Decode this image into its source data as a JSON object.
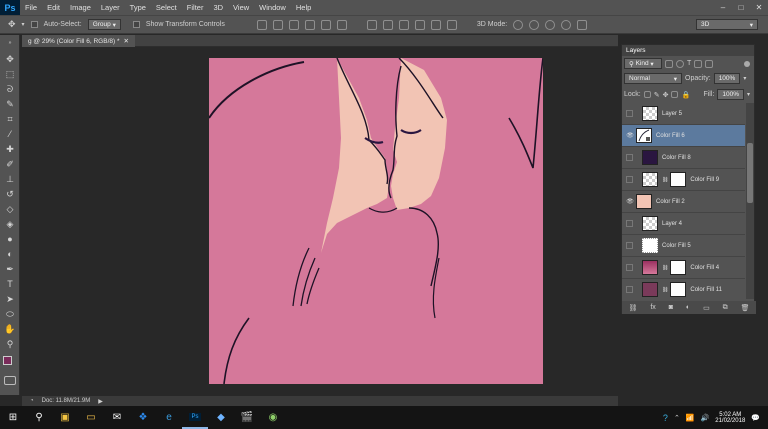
{
  "menubar": {
    "logo": "Ps",
    "items": [
      "File",
      "Edit",
      "Image",
      "Layer",
      "Type",
      "Select",
      "Filter",
      "3D",
      "View",
      "Window",
      "Help"
    ]
  },
  "options": {
    "auto_select_label": "Auto-Select:",
    "auto_select_value": "Group",
    "show_transform_label": "Show Transform Controls",
    "mode_3d_label": "3D Mode:",
    "workspace_value": "3D"
  },
  "document": {
    "tab_title": "g @ 29% (Color Fill 6, RGB/8) *",
    "doc_size": "Doc: 11.8M/21.9M"
  },
  "layers_panel": {
    "title": "Layers",
    "filter_label": "Kind",
    "blend_mode": "Normal",
    "opacity_label": "Opacity:",
    "opacity_value": "100%",
    "lock_label": "Lock:",
    "fill_label": "Fill:",
    "fill_value": "100%",
    "layers": [
      {
        "name": "Layer 5",
        "visible": false,
        "type": "pixel",
        "selected": false
      },
      {
        "name": "Color Fill 6",
        "visible": true,
        "type": "fill",
        "selected": true
      },
      {
        "name": "Color Fill 8",
        "visible": false,
        "type": "fill-dark",
        "selected": false
      },
      {
        "name": "Color Fill 9",
        "visible": false,
        "type": "fill-mask",
        "selected": false
      },
      {
        "name": "Color Fill 2",
        "visible": true,
        "type": "fill-face",
        "selected": false
      },
      {
        "name": "Layer 4",
        "visible": false,
        "type": "pixel",
        "selected": false
      },
      {
        "name": "Color Fill 5",
        "visible": false,
        "type": "fill-outline",
        "selected": false
      },
      {
        "name": "Color Fill 4",
        "visible": false,
        "type": "fill-mask",
        "selected": false
      },
      {
        "name": "Color Fill 11",
        "visible": false,
        "type": "fill-mask",
        "selected": false
      }
    ]
  },
  "taskbar": {
    "time": "5:02 AM",
    "date": "21/02/2018"
  },
  "colors": {
    "canvas_pink": "#d5789a",
    "skin": "#f2c4b4",
    "ui_panel": "#535353",
    "selected_row": "#5c7a9e"
  }
}
